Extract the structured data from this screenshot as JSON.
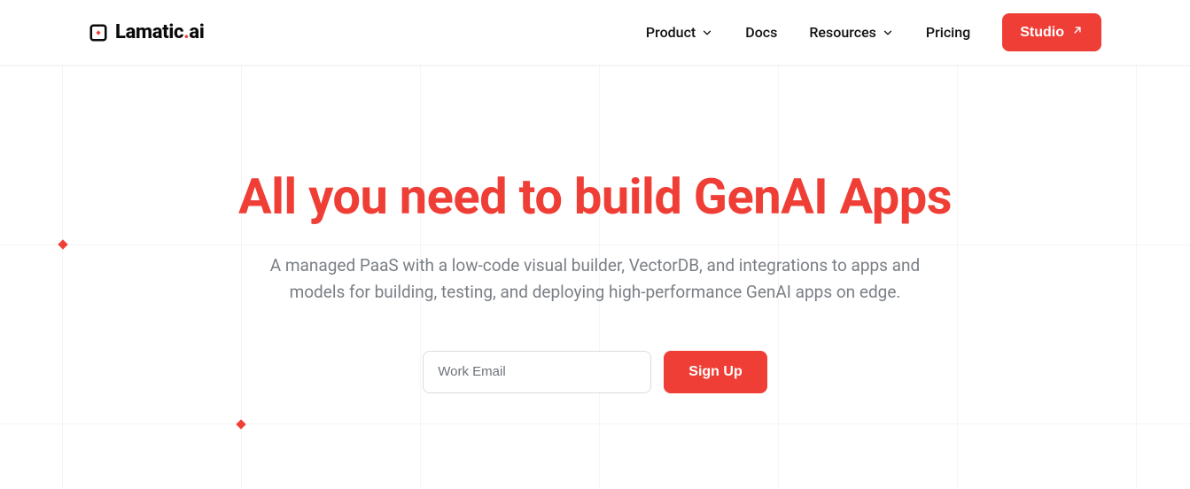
{
  "brand": {
    "name_pre": "Lamatic",
    "name_dot": ".",
    "name_post": "ai"
  },
  "nav": {
    "product": "Product",
    "docs": "Docs",
    "resources": "Resources",
    "pricing": "Pricing",
    "studio": "Studio"
  },
  "hero": {
    "headline": "All you need to build GenAI Apps",
    "subtext": "A managed PaaS with a low-code visual builder, VectorDB, and integrations to apps and models for building, testing, and deploying high-performance GenAI apps on edge."
  },
  "signup": {
    "placeholder": "Work Email",
    "button": "Sign Up"
  },
  "colors": {
    "accent": "#ef3e36"
  }
}
